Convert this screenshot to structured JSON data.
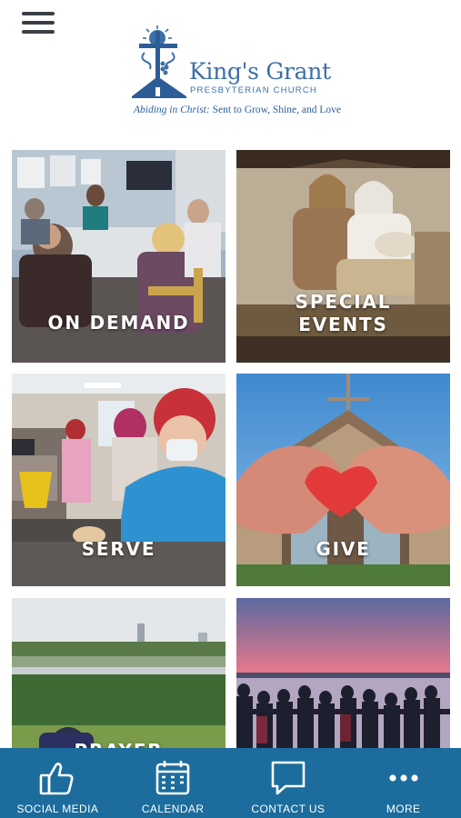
{
  "header": {
    "menu_icon": "hamburger-menu-icon",
    "logo": {
      "name": "King's Grant",
      "subtitle": "PRESBYTERIAN CHURCH",
      "tagline_italic": "Abiding in Christ:",
      "tagline_rest": " Sent to Grow, Shine, and Love",
      "brand_color": "#3d6fa8"
    }
  },
  "tiles": [
    {
      "label": "ON DEMAND"
    },
    {
      "label_line1": "SPECIAL",
      "label_line2": "EVENTS"
    },
    {
      "label": "SERVE"
    },
    {
      "label": "GIVE"
    },
    {
      "label": "PRAYER"
    },
    {
      "label": ""
    }
  ],
  "tabbar": {
    "color": "#1c6c9d",
    "tabs": [
      {
        "label": "SOCIAL MEDIA",
        "icon": "thumbs-up-icon"
      },
      {
        "label": "CALENDAR",
        "icon": "calendar-icon"
      },
      {
        "label": "CONTACT US",
        "icon": "chat-bubble-icon"
      },
      {
        "label": "MORE",
        "icon": "more-dots-icon"
      }
    ]
  }
}
